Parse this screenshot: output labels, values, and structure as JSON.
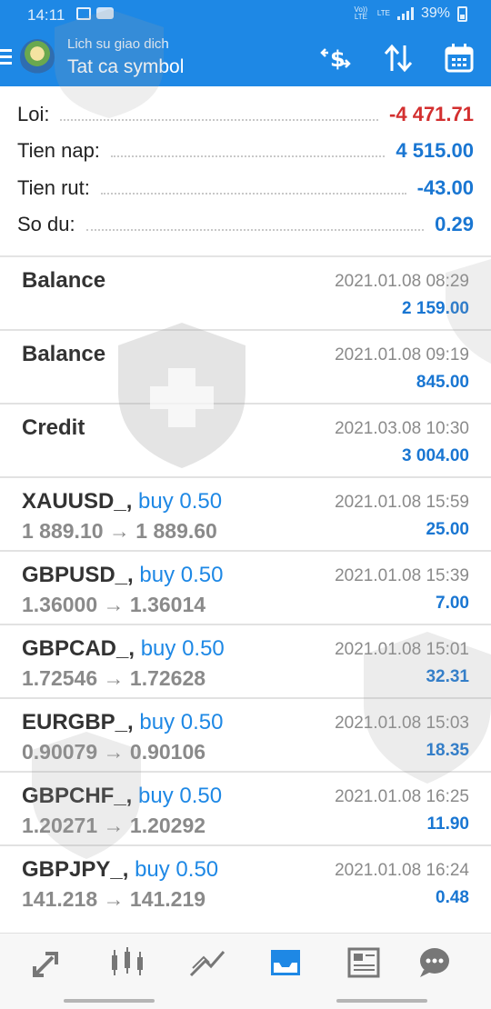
{
  "status_bar": {
    "time": "14:11",
    "volte": "Vo)) LTE",
    "lte": "LTE",
    "battery": "39%"
  },
  "header": {
    "subtitle": "Lich su giao dich",
    "title": "Tat ca symbol"
  },
  "summary": [
    {
      "label": "Loi:",
      "value": "-4 471.71",
      "color": "#d32f2f"
    },
    {
      "label": "Tien nap:",
      "value": "4 515.00",
      "color": "#1976d2"
    },
    {
      "label": "Tien rut:",
      "value": "-43.00",
      "color": "#1976d2"
    },
    {
      "label": "So du:",
      "value": "0.29",
      "color": "#1976d2"
    }
  ],
  "transactions": [
    {
      "name": "Balance",
      "type": "",
      "prices": "",
      "date": "2021.01.08 08:29",
      "amount": "2 159.00"
    },
    {
      "name": "Balance",
      "type": "",
      "prices": "",
      "date": "2021.01.08 09:19",
      "amount": "845.00"
    },
    {
      "name": "Credit",
      "type": "",
      "prices": "",
      "date": "2021.03.08 10:30",
      "amount": "3 004.00"
    },
    {
      "name": "XAUUSD_,",
      "type": "buy 0.50",
      "prices": "1 889.10 → 1 889.60",
      "date": "2021.01.08 15:59",
      "amount": "25.00"
    },
    {
      "name": "GBPUSD_,",
      "type": "buy 0.50",
      "prices": "1.36000 → 1.36014",
      "date": "2021.01.08 15:39",
      "amount": "7.00"
    },
    {
      "name": "GBPCAD_,",
      "type": "buy 0.50",
      "prices": "1.72546 → 1.72628",
      "date": "2021.01.08 15:01",
      "amount": "32.31"
    },
    {
      "name": "EURGBP_,",
      "type": "buy 0.50",
      "prices": "0.90079 → 0.90106",
      "date": "2021.01.08 15:03",
      "amount": "18.35"
    },
    {
      "name": "GBPCHF_,",
      "type": "buy 0.50",
      "prices": "1.20271 → 1.20292",
      "date": "2021.01.08 16:25",
      "amount": "11.90"
    },
    {
      "name": "GBPJPY_,",
      "type": "buy 0.50",
      "prices": "141.218 → 141.219",
      "date": "2021.01.08 16:24",
      "amount": "0.48"
    }
  ],
  "bottom_nav": [
    {
      "icon": "quotes-icon",
      "active": false
    },
    {
      "icon": "chart-icon",
      "active": false
    },
    {
      "icon": "trade-icon",
      "active": false
    },
    {
      "icon": "history-icon",
      "active": true
    },
    {
      "icon": "news-icon",
      "active": false
    },
    {
      "icon": "chat-icon",
      "active": false
    }
  ],
  "colors": {
    "accent": "#1e88e5",
    "negative": "#d32f2f",
    "value_blue": "#1976d2"
  }
}
